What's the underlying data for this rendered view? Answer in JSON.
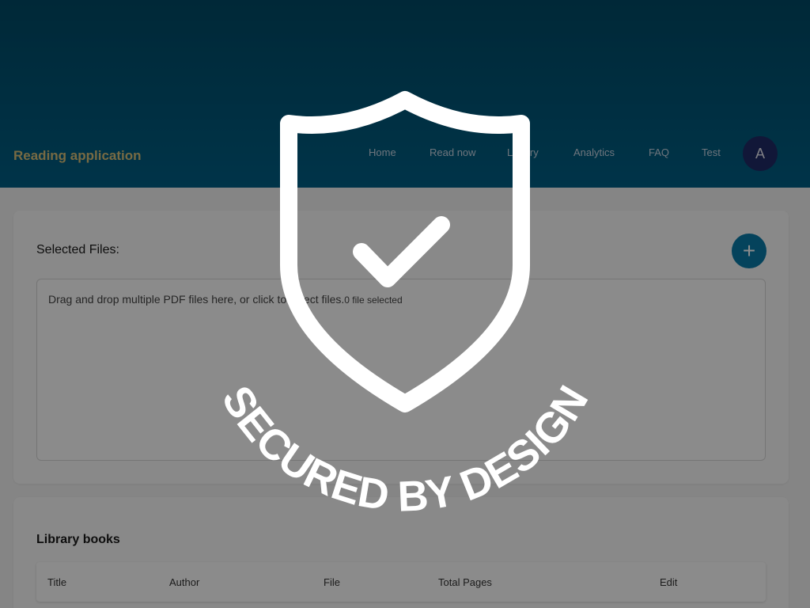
{
  "header": {
    "app_title": "Reading application",
    "nav": [
      {
        "label": "Home"
      },
      {
        "label": "Read now"
      },
      {
        "label": "Library"
      },
      {
        "label": "Analytics"
      },
      {
        "label": "FAQ"
      },
      {
        "label": "Test"
      }
    ],
    "avatar_initial": "A"
  },
  "files": {
    "title": "Selected Files:",
    "add_glyph": "+",
    "dropzone_text": "Drag and drop multiple PDF files here, or click to select files.",
    "file_count": "0 file selected"
  },
  "library": {
    "title": "Library books",
    "columns": [
      "Title",
      "Author",
      "File",
      "Total Pages",
      "Edit"
    ]
  },
  "overlay": {
    "badge_text": "SECURED BY DESIGN",
    "icon": "shield-check-icon"
  },
  "colors": {
    "header": "#005f85",
    "accent": "#0a7aa8",
    "avatar": "#1f2a66",
    "app_title": "#d9c27a"
  }
}
